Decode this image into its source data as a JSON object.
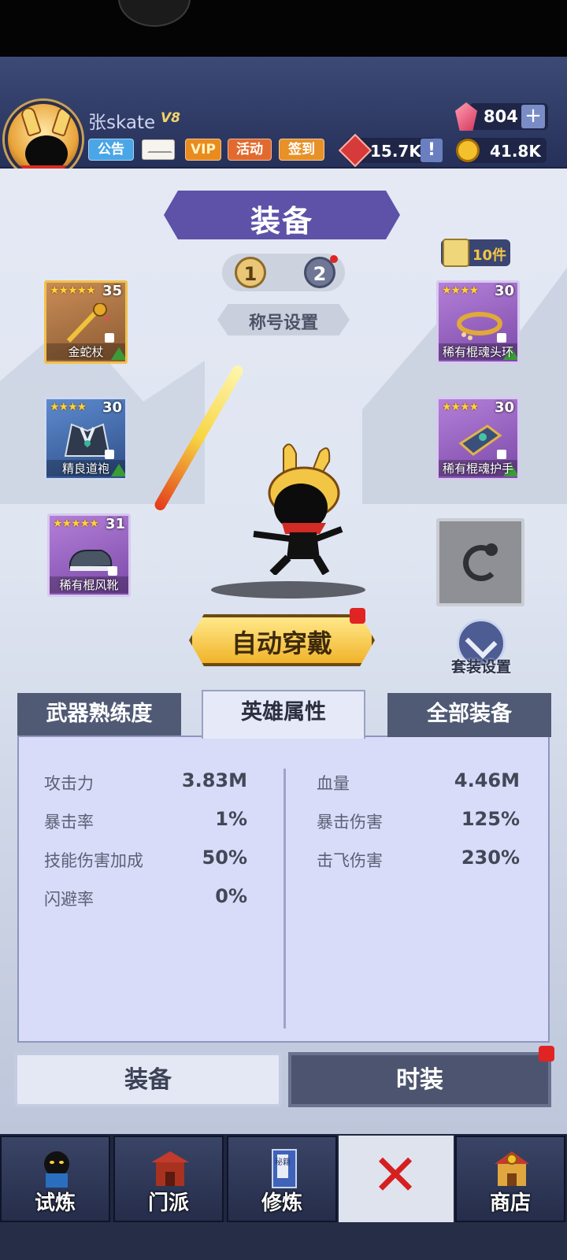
{
  "player": {
    "name": "张skate",
    "vip_level": "V8",
    "gems": "804",
    "honor": "15.7K",
    "coins": "41.8K"
  },
  "header_buttons": {
    "notice": "公告",
    "vip": "VIP",
    "activity": "活动",
    "signin": "签到",
    "plus": "+",
    "alert": "!"
  },
  "screen": {
    "title": "装备",
    "page1": "1",
    "page2": "2",
    "pieces_count": "10件",
    "title_setting": "称号设置",
    "auto_equip": "自动穿戴",
    "suit_setting": "套装设置"
  },
  "slots": [
    {
      "name": "金蛇杖",
      "level": "35",
      "stars": "★★★★★",
      "rarity": "orange"
    },
    {
      "name": "精良道袍",
      "level": "30",
      "stars": "★★★★",
      "rarity": "blue"
    },
    {
      "name": "稀有棍风靴",
      "level": "31",
      "stars": "★★★★★",
      "rarity": "purple"
    },
    {
      "name": "稀有棍魂头环",
      "level": "30",
      "stars": "★★★★",
      "rarity": "purple"
    },
    {
      "name": "稀有棍魂护手",
      "level": "30",
      "stars": "★★★★",
      "rarity": "purple"
    }
  ],
  "tabs": {
    "weapon_mastery": "武器熟练度",
    "hero_attributes": "英雄属性",
    "all_equipment": "全部装备"
  },
  "stats_left": [
    {
      "label": "攻击力",
      "value": "3.83M"
    },
    {
      "label": "暴击率",
      "value": "1%"
    },
    {
      "label": "技能伤害加成",
      "value": "50%"
    },
    {
      "label": "闪避率",
      "value": "0%"
    }
  ],
  "stats_right": [
    {
      "label": "血量",
      "value": "4.46M"
    },
    {
      "label": "暴击伤害",
      "value": "125%"
    },
    {
      "label": "击飞伤害",
      "value": "230%"
    }
  ],
  "bottom_tabs": {
    "equipment": "装备",
    "fashion": "时装"
  },
  "nav": [
    {
      "label": "试炼",
      "icon": "ninja-icon"
    },
    {
      "label": "门派",
      "icon": "temple-icon"
    },
    {
      "label": "修炼",
      "icon": "secret-book-icon",
      "book_text": "秘籍"
    },
    {
      "label": "",
      "icon": "crossed-swords-icon"
    },
    {
      "label": "商店",
      "icon": "shop-icon"
    }
  ],
  "colors": {
    "header_bg": "#3c4a76",
    "title_banner": "#5d52a8",
    "auto_equip_gold": "#f1b32a",
    "panel_bg": "#d9dcf8",
    "notification_red": "#e02424"
  }
}
